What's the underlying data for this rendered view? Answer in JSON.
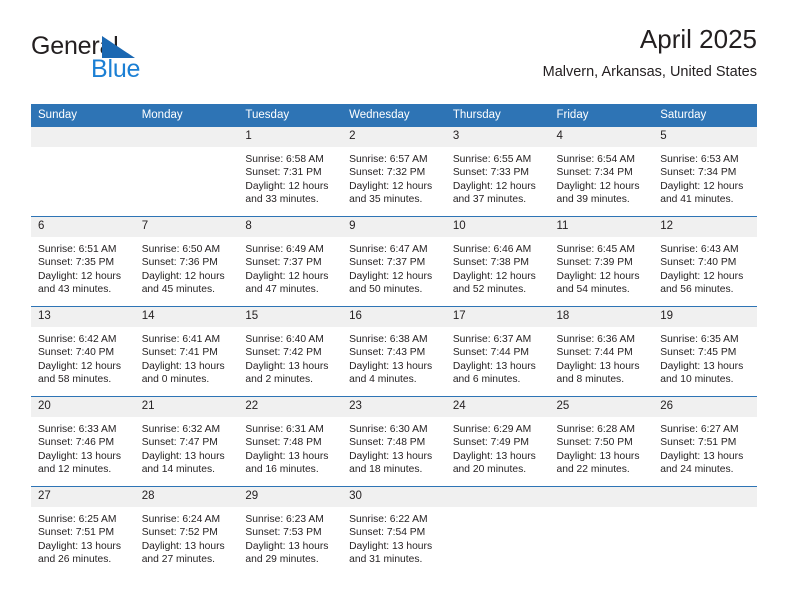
{
  "brand": {
    "name_part1": "General",
    "name_part2": "Blue",
    "accent_color": "#1b7fd4",
    "triangle_color": "#1b68b2"
  },
  "header": {
    "title": "April 2025",
    "subtitle": "Malvern, Arkansas, United States",
    "header_bg": "#2e74b5",
    "daynum_bg": "#f0f0f0"
  },
  "weekday_headers": [
    "Sunday",
    "Monday",
    "Tuesday",
    "Wednesday",
    "Thursday",
    "Friday",
    "Saturday"
  ],
  "labels": {
    "sunrise": "Sunrise:",
    "sunset": "Sunset:",
    "daylight": "Daylight:"
  },
  "weeks": [
    [
      {
        "day": "",
        "empty": true
      },
      {
        "day": "",
        "empty": true
      },
      {
        "day": "1",
        "sunrise": "Sunrise: 6:58 AM",
        "sunset": "Sunset: 7:31 PM",
        "daylight": "Daylight: 12 hours and 33 minutes."
      },
      {
        "day": "2",
        "sunrise": "Sunrise: 6:57 AM",
        "sunset": "Sunset: 7:32 PM",
        "daylight": "Daylight: 12 hours and 35 minutes."
      },
      {
        "day": "3",
        "sunrise": "Sunrise: 6:55 AM",
        "sunset": "Sunset: 7:33 PM",
        "daylight": "Daylight: 12 hours and 37 minutes."
      },
      {
        "day": "4",
        "sunrise": "Sunrise: 6:54 AM",
        "sunset": "Sunset: 7:34 PM",
        "daylight": "Daylight: 12 hours and 39 minutes."
      },
      {
        "day": "5",
        "sunrise": "Sunrise: 6:53 AM",
        "sunset": "Sunset: 7:34 PM",
        "daylight": "Daylight: 12 hours and 41 minutes."
      }
    ],
    [
      {
        "day": "6",
        "sunrise": "Sunrise: 6:51 AM",
        "sunset": "Sunset: 7:35 PM",
        "daylight": "Daylight: 12 hours and 43 minutes."
      },
      {
        "day": "7",
        "sunrise": "Sunrise: 6:50 AM",
        "sunset": "Sunset: 7:36 PM",
        "daylight": "Daylight: 12 hours and 45 minutes."
      },
      {
        "day": "8",
        "sunrise": "Sunrise: 6:49 AM",
        "sunset": "Sunset: 7:37 PM",
        "daylight": "Daylight: 12 hours and 47 minutes."
      },
      {
        "day": "9",
        "sunrise": "Sunrise: 6:47 AM",
        "sunset": "Sunset: 7:37 PM",
        "daylight": "Daylight: 12 hours and 50 minutes."
      },
      {
        "day": "10",
        "sunrise": "Sunrise: 6:46 AM",
        "sunset": "Sunset: 7:38 PM",
        "daylight": "Daylight: 12 hours and 52 minutes."
      },
      {
        "day": "11",
        "sunrise": "Sunrise: 6:45 AM",
        "sunset": "Sunset: 7:39 PM",
        "daylight": "Daylight: 12 hours and 54 minutes."
      },
      {
        "day": "12",
        "sunrise": "Sunrise: 6:43 AM",
        "sunset": "Sunset: 7:40 PM",
        "daylight": "Daylight: 12 hours and 56 minutes."
      }
    ],
    [
      {
        "day": "13",
        "sunrise": "Sunrise: 6:42 AM",
        "sunset": "Sunset: 7:40 PM",
        "daylight": "Daylight: 12 hours and 58 minutes."
      },
      {
        "day": "14",
        "sunrise": "Sunrise: 6:41 AM",
        "sunset": "Sunset: 7:41 PM",
        "daylight": "Daylight: 13 hours and 0 minutes."
      },
      {
        "day": "15",
        "sunrise": "Sunrise: 6:40 AM",
        "sunset": "Sunset: 7:42 PM",
        "daylight": "Daylight: 13 hours and 2 minutes."
      },
      {
        "day": "16",
        "sunrise": "Sunrise: 6:38 AM",
        "sunset": "Sunset: 7:43 PM",
        "daylight": "Daylight: 13 hours and 4 minutes."
      },
      {
        "day": "17",
        "sunrise": "Sunrise: 6:37 AM",
        "sunset": "Sunset: 7:44 PM",
        "daylight": "Daylight: 13 hours and 6 minutes."
      },
      {
        "day": "18",
        "sunrise": "Sunrise: 6:36 AM",
        "sunset": "Sunset: 7:44 PM",
        "daylight": "Daylight: 13 hours and 8 minutes."
      },
      {
        "day": "19",
        "sunrise": "Sunrise: 6:35 AM",
        "sunset": "Sunset: 7:45 PM",
        "daylight": "Daylight: 13 hours and 10 minutes."
      }
    ],
    [
      {
        "day": "20",
        "sunrise": "Sunrise: 6:33 AM",
        "sunset": "Sunset: 7:46 PM",
        "daylight": "Daylight: 13 hours and 12 minutes."
      },
      {
        "day": "21",
        "sunrise": "Sunrise: 6:32 AM",
        "sunset": "Sunset: 7:47 PM",
        "daylight": "Daylight: 13 hours and 14 minutes."
      },
      {
        "day": "22",
        "sunrise": "Sunrise: 6:31 AM",
        "sunset": "Sunset: 7:48 PM",
        "daylight": "Daylight: 13 hours and 16 minutes."
      },
      {
        "day": "23",
        "sunrise": "Sunrise: 6:30 AM",
        "sunset": "Sunset: 7:48 PM",
        "daylight": "Daylight: 13 hours and 18 minutes."
      },
      {
        "day": "24",
        "sunrise": "Sunrise: 6:29 AM",
        "sunset": "Sunset: 7:49 PM",
        "daylight": "Daylight: 13 hours and 20 minutes."
      },
      {
        "day": "25",
        "sunrise": "Sunrise: 6:28 AM",
        "sunset": "Sunset: 7:50 PM",
        "daylight": "Daylight: 13 hours and 22 minutes."
      },
      {
        "day": "26",
        "sunrise": "Sunrise: 6:27 AM",
        "sunset": "Sunset: 7:51 PM",
        "daylight": "Daylight: 13 hours and 24 minutes."
      }
    ],
    [
      {
        "day": "27",
        "sunrise": "Sunrise: 6:25 AM",
        "sunset": "Sunset: 7:51 PM",
        "daylight": "Daylight: 13 hours and 26 minutes."
      },
      {
        "day": "28",
        "sunrise": "Sunrise: 6:24 AM",
        "sunset": "Sunset: 7:52 PM",
        "daylight": "Daylight: 13 hours and 27 minutes."
      },
      {
        "day": "29",
        "sunrise": "Sunrise: 6:23 AM",
        "sunset": "Sunset: 7:53 PM",
        "daylight": "Daylight: 13 hours and 29 minutes."
      },
      {
        "day": "30",
        "sunrise": "Sunrise: 6:22 AM",
        "sunset": "Sunset: 7:54 PM",
        "daylight": "Daylight: 13 hours and 31 minutes."
      },
      {
        "day": "",
        "empty": true
      },
      {
        "day": "",
        "empty": true
      },
      {
        "day": "",
        "empty": true
      }
    ]
  ]
}
